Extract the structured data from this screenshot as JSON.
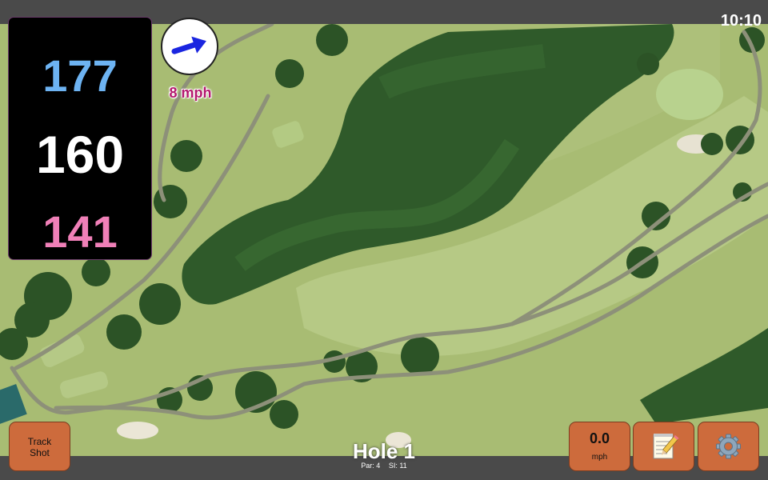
{
  "status_bar": {
    "time": "10:10"
  },
  "distances": {
    "back": "177",
    "middle": "160",
    "front": "141"
  },
  "colors": {
    "back": "#6db3f2",
    "middle": "#ffffff",
    "front": "#f080b8",
    "button": "#cd6b3c",
    "wind_text": "#b4186e"
  },
  "wind": {
    "speed": "8 mph",
    "direction_icon": "arrow-right-icon"
  },
  "buttons": {
    "track_shot": {
      "line1": "Track",
      "line2": "Shot"
    },
    "speed": {
      "value": "0.0",
      "unit": "mph"
    },
    "notes_icon": "notepad-icon",
    "settings_icon": "gear-icon"
  },
  "hole": {
    "title": "Hole 1",
    "par": "Par: 4",
    "si": "SI: 11"
  }
}
